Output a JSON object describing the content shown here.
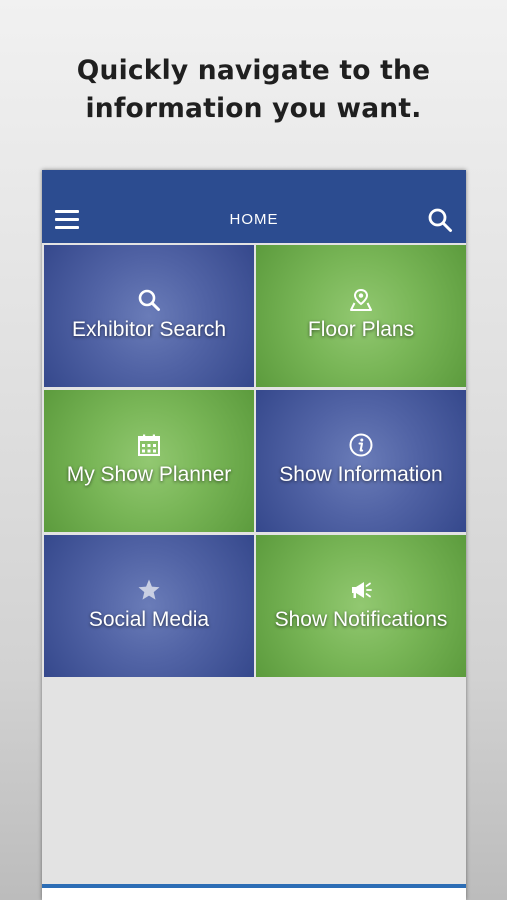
{
  "headline": {
    "line1": "Quickly navigate to the",
    "line2": "information you want."
  },
  "appbar": {
    "title": "HOME",
    "menu_icon": "hamburger-menu-icon",
    "search_icon": "search-icon"
  },
  "tiles": [
    {
      "label": "Exhibitor Search",
      "icon": "search-icon",
      "color": "blue"
    },
    {
      "label": "Floor Plans",
      "icon": "map-pin-icon",
      "color": "green"
    },
    {
      "label": "My Show Planner",
      "icon": "calendar-icon",
      "color": "green"
    },
    {
      "label": "Show Information",
      "icon": "info-icon",
      "color": "blue"
    },
    {
      "label": "Social Media",
      "icon": "star-icon",
      "color": "blue"
    },
    {
      "label": "Show Notifications",
      "icon": "megaphone-icon",
      "color": "green"
    }
  ],
  "colors": {
    "appbar": "#2c4c90",
    "tile_blue": "#5163a5",
    "tile_green": "#79b657",
    "accent_line": "#2c6db5"
  }
}
